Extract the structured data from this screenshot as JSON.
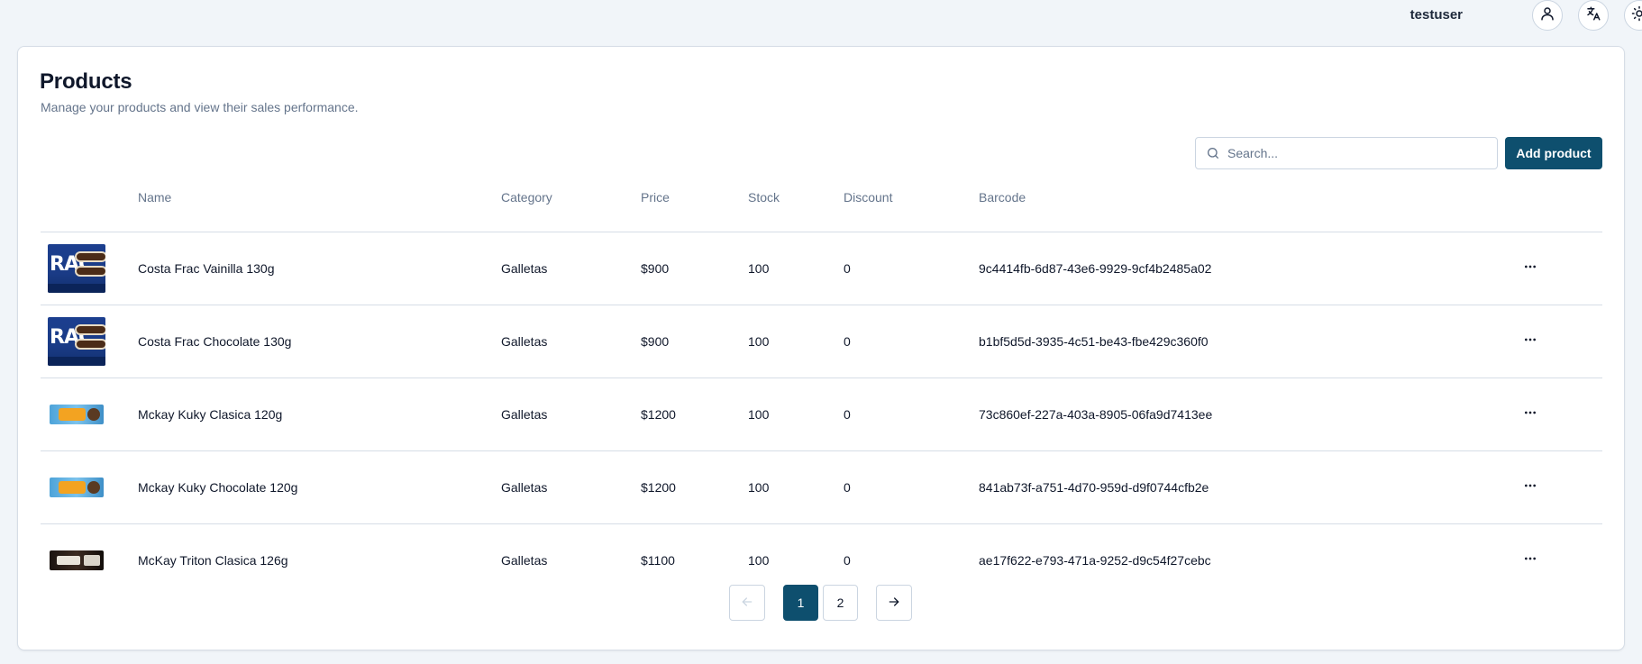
{
  "header": {
    "username": "testuser",
    "icons": [
      "user-icon",
      "translate-icon",
      "sun-icon"
    ]
  },
  "page": {
    "title": "Products",
    "description": "Manage your products and view their sales performance."
  },
  "search": {
    "placeholder": "Search..."
  },
  "actions": {
    "add_label": "Add product"
  },
  "table": {
    "columns": [
      "Name",
      "Category",
      "Price",
      "Stock",
      "Discount",
      "Barcode"
    ],
    "rows": [
      {
        "image": "frac",
        "name": "Costa Frac Vainilla 130g",
        "category": "Galletas",
        "price": "$900",
        "stock": "100",
        "discount": "0",
        "barcode": "9c4414fb-6d87-43e6-9929-9cf4b2485a02"
      },
      {
        "image": "frac",
        "name": "Costa Frac Chocolate 130g",
        "category": "Galletas",
        "price": "$900",
        "stock": "100",
        "discount": "0",
        "barcode": "b1bf5d5d-3935-4c51-be43-fbe429c360f0"
      },
      {
        "image": "kuky",
        "name": "Mckay Kuky Clasica 120g",
        "category": "Galletas",
        "price": "$1200",
        "stock": "100",
        "discount": "0",
        "barcode": "73c860ef-227a-403a-8905-06fa9d7413ee"
      },
      {
        "image": "kuky",
        "name": "Mckay Kuky Chocolate 120g",
        "category": "Galletas",
        "price": "$1200",
        "stock": "100",
        "discount": "0",
        "barcode": "841ab73f-a751-4d70-959d-d9f0744cfb2e"
      },
      {
        "image": "triton",
        "name": "McKay Triton Clasica 126g",
        "category": "Galletas",
        "price": "$1100",
        "stock": "100",
        "discount": "0",
        "barcode": "ae17f622-e793-471a-9252-d9c54f27cebc"
      }
    ]
  },
  "pagination": {
    "pages": [
      "1",
      "2"
    ],
    "current": "1",
    "prev_icon": "arrow-left-icon",
    "next_icon": "arrow-right-icon"
  },
  "colors": {
    "accent": "#0e4f6e",
    "background": "#f1f5f9",
    "muted_text": "#64748b",
    "border": "#d6dde6"
  }
}
